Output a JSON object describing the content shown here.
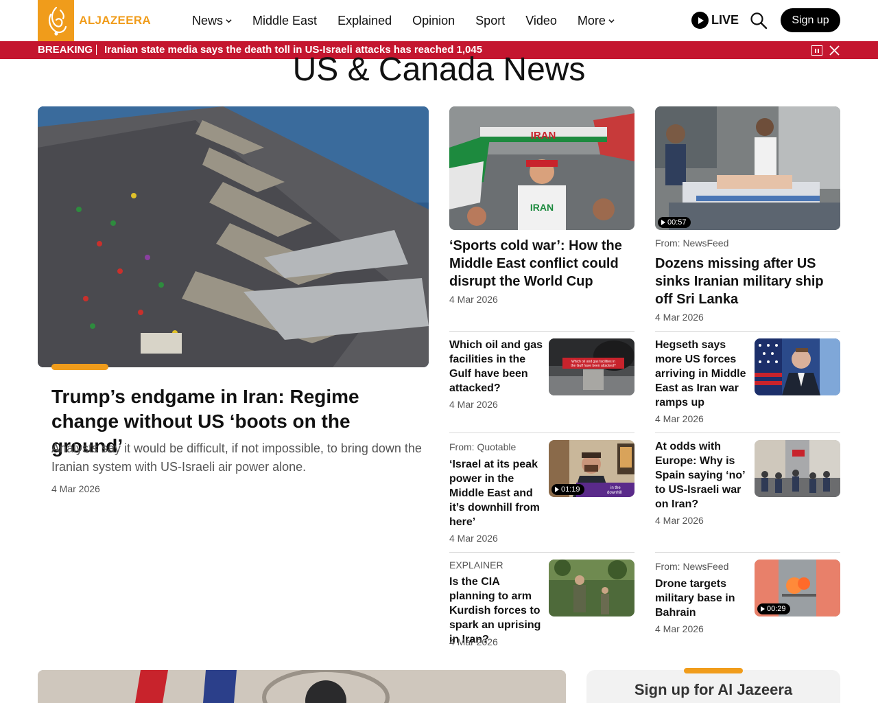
{
  "brand": {
    "name": "ALJAZEERA",
    "accent": "#f09c1b"
  },
  "nav": {
    "items": [
      {
        "label": "News",
        "dropdown": true
      },
      {
        "label": "Middle East",
        "dropdown": false
      },
      {
        "label": "Explained",
        "dropdown": false
      },
      {
        "label": "Opinion",
        "dropdown": false
      },
      {
        "label": "Sport",
        "dropdown": false
      },
      {
        "label": "Video",
        "dropdown": false
      },
      {
        "label": "More",
        "dropdown": true
      }
    ],
    "live_label": "LIVE",
    "signup_label": "Sign up"
  },
  "breaking": {
    "label": "BREAKING",
    "text": "Iranian state media says the death toll in US-Israeli attacks has reached 1,045",
    "color": "#c4162f"
  },
  "page_title": "US & Canada News",
  "featured": {
    "title": "Trump’s endgame in Iran: Regime change without US ‘boots on the ground’",
    "summary": "Analysts say it would be difficult, if not impossible, to bring down the Iranian system with US-Israeli air power alone.",
    "date": "4 Mar 2026"
  },
  "top_cards": [
    {
      "title": "‘Sports cold war’: How the Middle East conflict could disrupt the World Cup",
      "date": "4 Mar 2026"
    },
    {
      "source": "From: NewsFeed",
      "title": "Dozens missing after US sinks Iranian military ship off Sri Lanka",
      "date": "4 Mar 2026",
      "duration": "00:57"
    }
  ],
  "list_left": [
    {
      "title": "Which oil and gas facilities in the Gulf have been attacked?",
      "date": "4 Mar 2026",
      "thumb_caption": "Which oil and gas facilities in the Gulf have been attacked?"
    },
    {
      "source": "From: Quotable",
      "title": "‘Israel at its peak power in the Middle East and it’s downhill from here’",
      "date": "4 Mar 2026",
      "duration": "01:19"
    },
    {
      "source": "EXPLAINER",
      "title": "Is the CIA planning to arm Kurdish forces to spark an uprising in Iran?",
      "date": "4 Mar 2026"
    }
  ],
  "list_right": [
    {
      "title": "Hegseth says more US forces arriving in Middle East as Iran war ramps up",
      "date": "4 Mar 2026"
    },
    {
      "title": "At odds with Europe: Why is Spain saying ‘no’ to US-Israeli war on Iran?",
      "date": "4 Mar 2026"
    },
    {
      "source": "From: NewsFeed",
      "title": "Drone targets military base in Bahrain",
      "date": "4 Mar 2026",
      "duration": "00:29"
    }
  ],
  "newsletter": {
    "title": "Sign up for Al Jazeera"
  }
}
